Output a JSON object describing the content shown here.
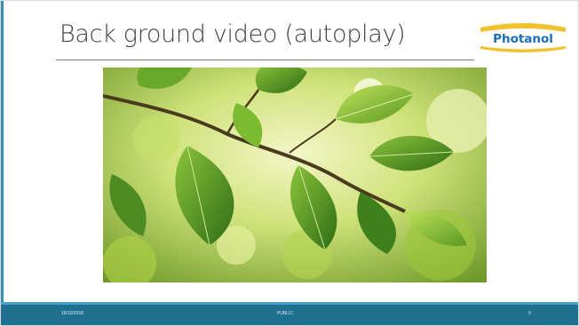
{
  "slide": {
    "title": "Back ground video (autoplay)",
    "logo_text": "Photanol",
    "media": {
      "type": "video",
      "autoplay": true,
      "subject": "green leaves on a branch in sunlight"
    }
  },
  "footer": {
    "date": "16/10/2018",
    "classification": "PUBLIC",
    "page_number": "9"
  },
  "colors": {
    "footer_bar": "#1f6f8e",
    "footer_accent": "#4aa4c8",
    "logo_blue": "#1a6fb5",
    "logo_yellow": "#f2c12e",
    "title_text": "#404040"
  },
  "icons": [
    "photanol-logo"
  ]
}
